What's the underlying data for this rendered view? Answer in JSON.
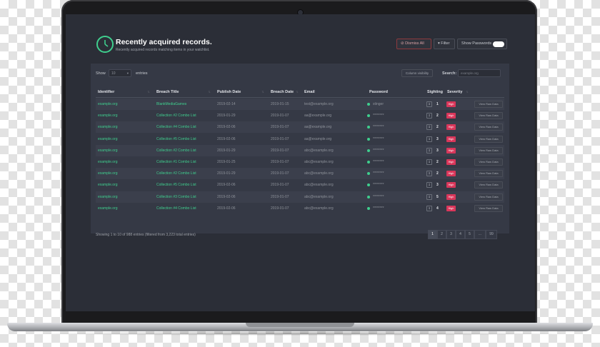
{
  "header": {
    "title": "Recently acquired records.",
    "subtitle": "Recently acquired records matching items in your watchlist.",
    "dismiss_label": "Dismiss All",
    "filter_label": "Filter",
    "show_passwords_label": "Show Passwords",
    "show_passwords_on": true
  },
  "controls": {
    "show_label": "Show",
    "page_size": "10",
    "entries_label": "entries",
    "column_visibility_label": "Column visibility",
    "search_label": "Search:",
    "search_placeholder": "example.org"
  },
  "table": {
    "columns": [
      "Identifier",
      "Breach Title",
      "Publish Date",
      "Breach Date",
      "Email",
      "Password",
      "Sighting",
      "Severity"
    ],
    "view_label": "View Raw Data",
    "severity_label": "High",
    "rows": [
      {
        "identifier": "example.org",
        "breach_title": "BlankMediaGames",
        "publish_date": "2019-02-14",
        "breach_date": "2019-01-15",
        "email": "test@example.org",
        "password": "stinger",
        "sighting": "1"
      },
      {
        "identifier": "example.org",
        "breach_title": "Collection #2 Combo List",
        "publish_date": "2019-01-29",
        "breach_date": "2019-01-07",
        "email": "aa@example.org",
        "password": "********",
        "sighting": "2"
      },
      {
        "identifier": "example.org",
        "breach_title": "Collection #4 Combo List",
        "publish_date": "2019-02-06",
        "breach_date": "2019-01-07",
        "email": "aa@example.org",
        "password": "********",
        "sighting": "2"
      },
      {
        "identifier": "example.org",
        "breach_title": "Collection #5 Combo List",
        "publish_date": "2019-02-06",
        "breach_date": "2019-01-07",
        "email": "aa@example.org",
        "password": "********",
        "sighting": "3"
      },
      {
        "identifier": "example.org",
        "breach_title": "Collection #2 Combo List",
        "publish_date": "2019-01-29",
        "breach_date": "2019-01-07",
        "email": "abc@example.org",
        "password": "********",
        "sighting": "3"
      },
      {
        "identifier": "example.org",
        "breach_title": "Collection #1 Combo List",
        "publish_date": "2019-01-25",
        "breach_date": "2019-01-07",
        "email": "abc@example.org",
        "password": "********",
        "sighting": "2"
      },
      {
        "identifier": "example.org",
        "breach_title": "Collection #2 Combo List",
        "publish_date": "2019-01-29",
        "breach_date": "2019-01-07",
        "email": "abc@example.org",
        "password": "********",
        "sighting": "2"
      },
      {
        "identifier": "example.org",
        "breach_title": "Collection #5 Combo List",
        "publish_date": "2019-02-06",
        "breach_date": "2019-01-07",
        "email": "abc@example.org",
        "password": "********",
        "sighting": "3"
      },
      {
        "identifier": "example.org",
        "breach_title": "Collection #3 Combo List",
        "publish_date": "2019-02-06",
        "breach_date": "2019-01-07",
        "email": "abc@example.org",
        "password": "********",
        "sighting": "5"
      },
      {
        "identifier": "example.org",
        "breach_title": "Collection #4 Combo List",
        "publish_date": "2019-02-06",
        "breach_date": "2019-01-07",
        "email": "abc@example.org",
        "password": "********",
        "sighting": "4"
      }
    ]
  },
  "footer": {
    "info": "Showing 1 to 10 of 988 entries (filtered from 3,223 total entries)",
    "pages": [
      "1",
      "2",
      "3",
      "4",
      "5",
      "...",
      "99"
    ],
    "active_page": "1"
  },
  "colors": {
    "accent": "#3fcf8e",
    "severity_high": "#d9365a",
    "background": "#2b2e37"
  }
}
